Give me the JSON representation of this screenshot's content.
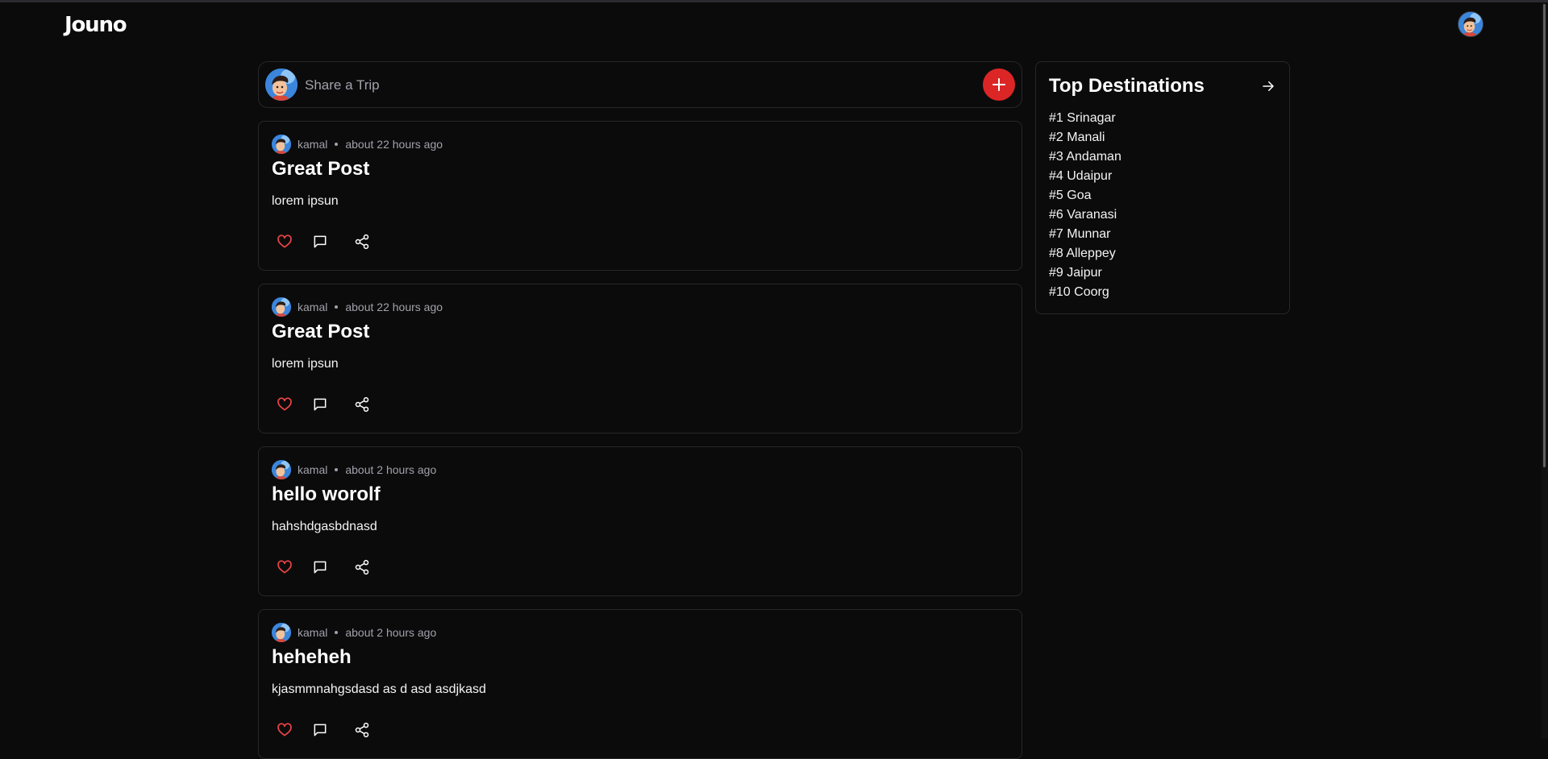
{
  "app": {
    "logo": "Jouno"
  },
  "composer": {
    "placeholder": "Share a Trip"
  },
  "posts": [
    {
      "author": "kamal",
      "time": "about 22 hours ago",
      "title": "Great Post",
      "body": "lorem ipsun"
    },
    {
      "author": "kamal",
      "time": "about 22 hours ago",
      "title": "Great Post",
      "body": "lorem ipsun"
    },
    {
      "author": "kamal",
      "time": "about 2 hours ago",
      "title": "hello worolf",
      "body": "hahshdgasbdnasd"
    },
    {
      "author": "kamal",
      "time": "about 2 hours ago",
      "title": "heheheh",
      "body": "kjasmmnahgsdasd as d asd asdjkasd"
    }
  ],
  "destinations": {
    "title": "Top Destinations",
    "items": [
      "#1 Srinagar",
      "#2 Manali",
      "#3 Andaman",
      "#4 Udaipur",
      "#5 Goa",
      "#6 Varanasi",
      "#7 Munnar",
      "#8 Alleppey",
      "#9 Jaipur",
      "#10 Coorg"
    ]
  },
  "colors": {
    "background": "#0b0b0c",
    "border": "#27272a",
    "accent": "#dc2626",
    "muted_text": "#a1a1aa"
  },
  "icons": {
    "add": "plus-icon",
    "like": "heart-icon",
    "comment": "comment-icon",
    "share": "share-icon",
    "destinations_link": "arrow-right-icon"
  }
}
